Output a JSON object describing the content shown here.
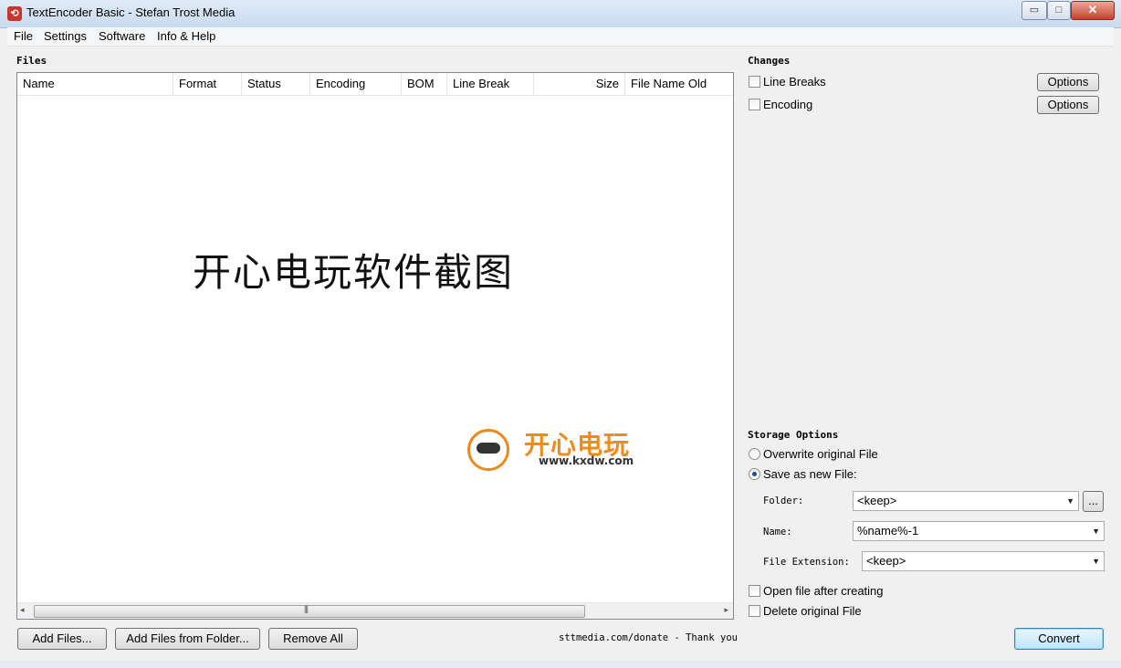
{
  "window": {
    "title": "TextEncoder Basic - Stefan Trost Media",
    "minimize": "▭",
    "maximize": "□",
    "close": "✕"
  },
  "menu": [
    "File",
    "Settings",
    "Software",
    "Info & Help"
  ],
  "files": {
    "section_label": "Files",
    "columns": [
      "Name",
      "Format",
      "Status",
      "Encoding",
      "BOM",
      "Line Break",
      "Size",
      "File Name Old"
    ],
    "watermark": "开心电玩软件截图",
    "logo_title": "开心电玩",
    "logo_url": "www.kxdw.com",
    "scroll_grip": "|||",
    "scroll_left": "◂",
    "scroll_right": "▸"
  },
  "bottom": {
    "add_files": "Add Files...",
    "add_from_folder": "Add Files from Folder...",
    "remove_all": "Remove All",
    "donate": "sttmedia.com/donate - Thank you"
  },
  "changes": {
    "section_label": "Changes",
    "line_breaks_label": "Line Breaks",
    "line_breaks_checked": false,
    "line_breaks_options": "Options",
    "encoding_label": "Encoding",
    "encoding_checked": false,
    "encoding_options": "Options"
  },
  "storage": {
    "section_label": "Storage Options",
    "overwrite_label": "Overwrite original File",
    "save_new_label": "Save as new File:",
    "selected": "save_new",
    "folder_label": "Folder:",
    "folder_value": "<keep>",
    "browse_label": "...",
    "name_label": "Name:",
    "name_value": "%name%-1",
    "ext_label": "File Extension:",
    "ext_value": "<keep>",
    "open_after_label": "Open file after creating",
    "open_after_checked": false,
    "delete_original_label": "Delete original File",
    "delete_original_checked": false,
    "convert_label": "Convert"
  }
}
